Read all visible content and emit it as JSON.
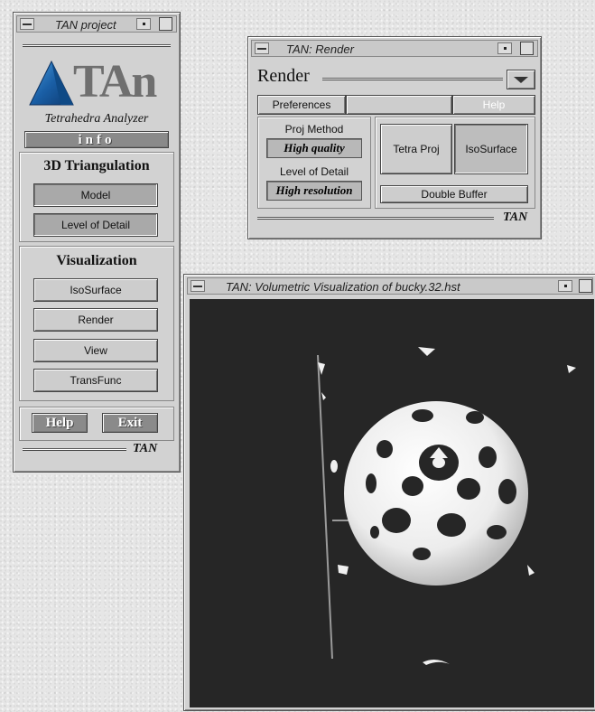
{
  "project_window": {
    "title": "TAN project",
    "logo_text": "TAn",
    "subtitle": "Tetrahedra Analyzer",
    "info_label": "info",
    "triangulation": {
      "heading": "3D Triangulation",
      "buttons": [
        "Model",
        "Level of Detail"
      ]
    },
    "visualization": {
      "heading": "Visualization",
      "buttons": [
        "IsoSurface",
        "Render",
        "View",
        "TransFunc"
      ]
    },
    "help_label": "Help",
    "exit_label": "Exit",
    "footer": "TAN"
  },
  "render_window": {
    "title": "TAN: Render",
    "header_label": "Render",
    "tabs": [
      "Preferences",
      "",
      "Help"
    ],
    "proj_method": {
      "label": "Proj Method",
      "value": "High quality"
    },
    "level_of_detail": {
      "label": "Level of Detail",
      "value": "High resolution"
    },
    "mode_buttons": [
      "Tetra Proj",
      "IsoSurface"
    ],
    "double_buffer_label": "Double Buffer",
    "footer": "TAN"
  },
  "viz_window": {
    "title": "TAN: Volumetric Visualization of bucky.32.hst"
  },
  "colors": {
    "window_bg": "#d2d2d2",
    "canvas_bg": "#262626",
    "logo_blue": "#1a5fa6",
    "logo_gray": "#6f6f6f"
  }
}
